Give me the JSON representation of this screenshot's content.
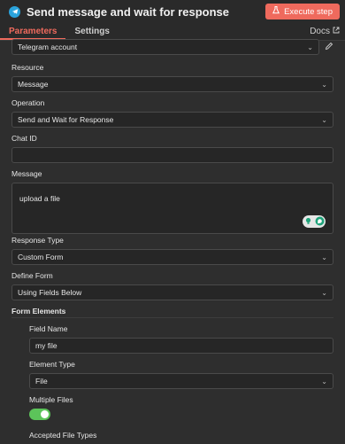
{
  "header": {
    "title": "Send message and wait for response",
    "execute_label": "Execute step"
  },
  "tabs": {
    "parameters": "Parameters",
    "settings": "Settings",
    "docs": "Docs"
  },
  "credential": {
    "value": "Telegram account"
  },
  "resource": {
    "label": "Resource",
    "value": "Message"
  },
  "operation": {
    "label": "Operation",
    "value": "Send and Wait for Response"
  },
  "chat_id": {
    "label": "Chat ID",
    "value": ""
  },
  "message": {
    "label": "Message",
    "value": "upload a file"
  },
  "response_type": {
    "label": "Response Type",
    "value": "Custom Form"
  },
  "define_form": {
    "label": "Define Form",
    "value": "Using Fields Below"
  },
  "form_elements": {
    "label": "Form Elements",
    "field_name": {
      "label": "Field Name",
      "value": "my file"
    },
    "element_type": {
      "label": "Element Type",
      "value": "File"
    },
    "multiple_files": {
      "label": "Multiple Files",
      "enabled": true
    },
    "accepted_types": {
      "label": "Accepted File Types"
    }
  },
  "colors": {
    "accent": "#ef6a5d",
    "toggle_on": "#5cc45a",
    "telegram": "#2aa3dc"
  }
}
